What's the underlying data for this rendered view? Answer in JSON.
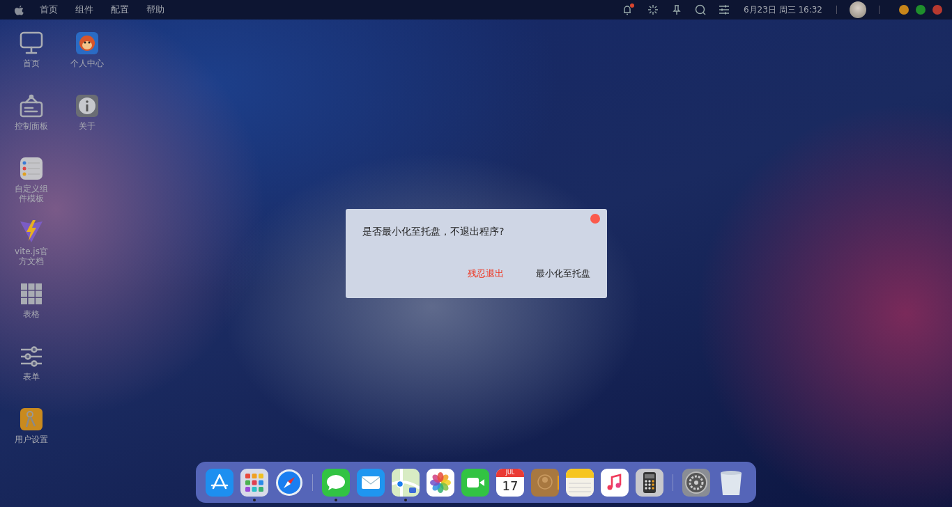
{
  "menu_bar": {
    "menus": [
      "首页",
      "组件",
      "配置",
      "帮助"
    ],
    "notification_unread": true,
    "datetime": "6月23日 周三 16:32",
    "window_controls": [
      {
        "color": "#c8861a"
      },
      {
        "color": "#1f8f2c"
      },
      {
        "color": "#b8392f"
      }
    ]
  },
  "desktop": {
    "columns": [
      [
        {
          "label": "首页",
          "kind": "monitor"
        },
        {
          "label": "控制面板",
          "kind": "sign"
        },
        {
          "label": "自定义组件模板",
          "kind": "reminders"
        },
        {
          "label": "vite.js官方文档",
          "kind": "vite"
        },
        {
          "label": "表格",
          "kind": "grid"
        },
        {
          "label": "表单",
          "kind": "sliders"
        },
        {
          "label": "用户设置",
          "kind": "keys"
        }
      ],
      [
        {
          "label": "个人中心",
          "kind": "mascot"
        },
        {
          "label": "关于",
          "kind": "info"
        }
      ]
    ]
  },
  "dialog": {
    "message": "是否最小化至托盘，不退出程序?",
    "buttons": [
      {
        "label": "残忍退出",
        "kind": "danger"
      },
      {
        "label": "最小化至托盘",
        "kind": "normal"
      }
    ]
  },
  "dock": {
    "groups": [
      [
        {
          "kind": "appstore",
          "running": false
        },
        {
          "kind": "launchpad",
          "running": true
        },
        {
          "kind": "safari",
          "running": false
        }
      ],
      [
        {
          "kind": "messages",
          "running": true
        },
        {
          "kind": "mail",
          "running": false
        },
        {
          "kind": "maps",
          "running": true
        },
        {
          "kind": "photos",
          "running": false
        },
        {
          "kind": "facetime",
          "running": false
        },
        {
          "kind": "calendar",
          "running": false,
          "month": "JUL",
          "day": "17"
        },
        {
          "kind": "contacts",
          "running": false
        },
        {
          "kind": "notes",
          "running": false
        },
        {
          "kind": "music",
          "running": false
        },
        {
          "kind": "calculator",
          "running": false
        }
      ],
      [
        {
          "kind": "settings",
          "running": false
        },
        {
          "kind": "trash",
          "running": false
        }
      ]
    ]
  }
}
